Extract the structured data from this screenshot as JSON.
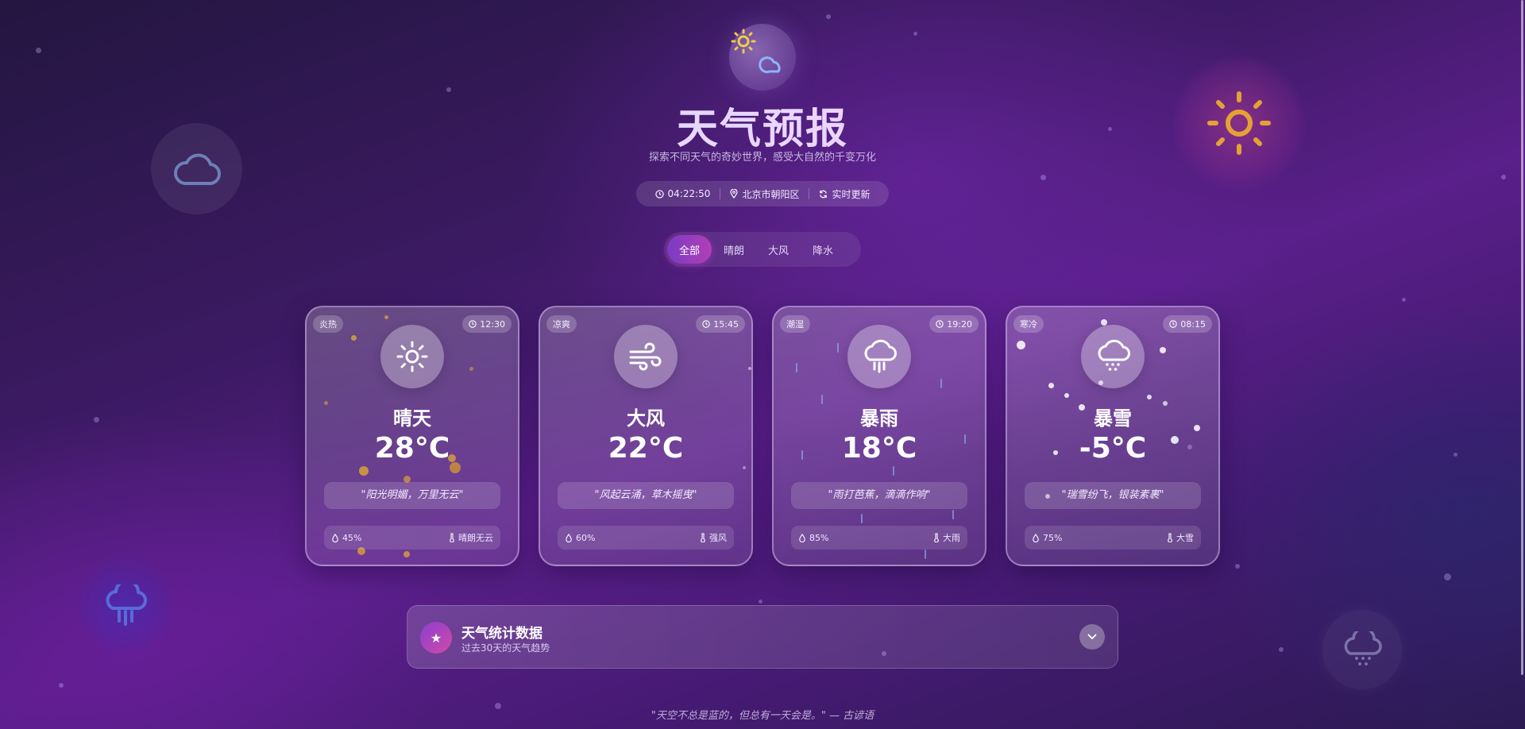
{
  "header": {
    "title": "天气预报",
    "subtitle": "探索不同天气的奇妙世界，感受大自然的千变万化"
  },
  "infobar": {
    "time": "04:22:50",
    "location": "北京市朝阳区",
    "refresh": "实时更新"
  },
  "tabs": [
    {
      "label": "全部",
      "active": true
    },
    {
      "label": "晴朗",
      "active": false
    },
    {
      "label": "大风",
      "active": false
    },
    {
      "label": "降水",
      "active": false
    }
  ],
  "cards": [
    {
      "tag": "炎热",
      "time": "12:30",
      "icon": "sun-icon",
      "name": "晴天",
      "temp": "28°C",
      "quote": "\"阳光明媚，万里无云\"",
      "humidity": "45%",
      "desc": "晴朗无云"
    },
    {
      "tag": "凉爽",
      "time": "15:45",
      "icon": "wind-icon",
      "name": "大风",
      "temp": "22°C",
      "quote": "\"风起云涌，草木摇曳\"",
      "humidity": "60%",
      "desc": "强风"
    },
    {
      "tag": "潮湿",
      "time": "19:20",
      "icon": "rain-icon",
      "name": "暴雨",
      "temp": "18°C",
      "quote": "\"雨打芭蕉，滴滴作响\"",
      "humidity": "85%",
      "desc": "大雨"
    },
    {
      "tag": "寒冷",
      "time": "08:15",
      "icon": "snow-icon",
      "name": "暴雪",
      "temp": "-5°C",
      "quote": "\"瑞雪纷飞，银装素裹\"",
      "humidity": "75%",
      "desc": "大雪"
    }
  ],
  "stats": {
    "icon": "star-icon",
    "title": "天气统计数据",
    "subtitle": "过去30天的天气趋势"
  },
  "footer": {
    "quote": "\"天空不总是蓝的，但总有一天会是。\" — 古谚语"
  },
  "colors": {
    "accent_start": "#7b3bc4",
    "accent_end": "#b13fb5",
    "sun": "#e8a832",
    "deco_cloud": "#6a7fb8"
  }
}
